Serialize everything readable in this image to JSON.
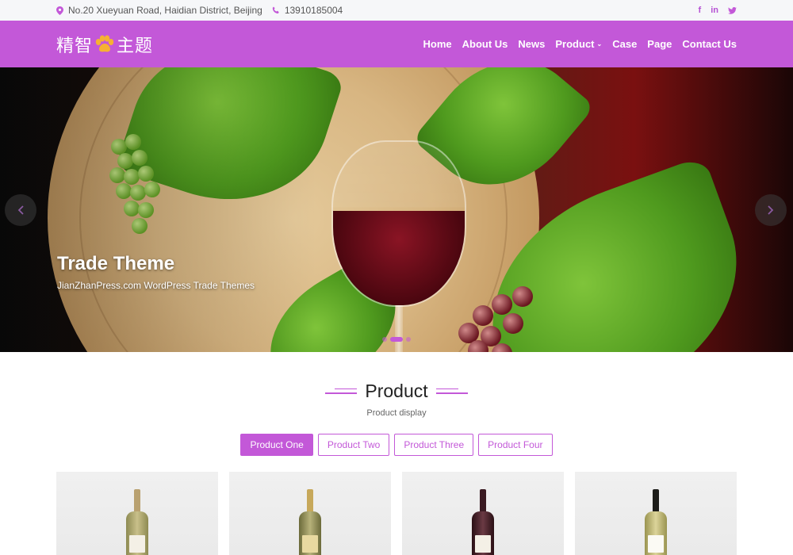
{
  "topbar": {
    "address": "No.20 Xueyuan Road, Haidian District, Beijing",
    "phone": "13910185004",
    "social": [
      "f",
      "in",
      "t"
    ]
  },
  "header": {
    "logo_left": "精智",
    "logo_right": "主题",
    "menu": [
      "Home",
      "About Us",
      "News",
      "Product",
      "Case",
      "Page",
      "Contact Us"
    ]
  },
  "hero": {
    "title": "Trade Theme",
    "subtitle": "JianZhanPress.com WordPress Trade Themes"
  },
  "section": {
    "title": "Product",
    "subtitle": "Product display"
  },
  "tabs": [
    "Product One",
    "Product Two",
    "Product Three",
    "Product Four"
  ],
  "colors": {
    "accent": "#c358d8",
    "paw": "#f6b133"
  }
}
